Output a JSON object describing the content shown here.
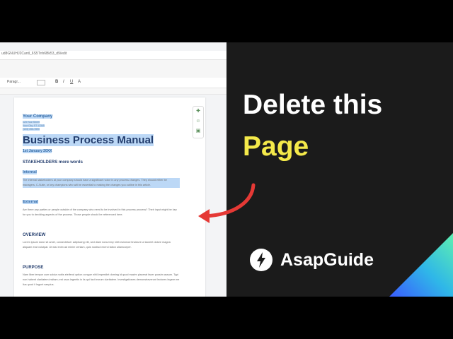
{
  "browser": {
    "url_fragment": "ud8GNUHJ2Cantl_6S5Tnh6Bk53_d9/edit"
  },
  "toolbar": {
    "style_select": "Paragr...",
    "bold": "B",
    "italic": "I",
    "underline": "U",
    "text_color": "A"
  },
  "document": {
    "company": "Your Company",
    "address_lines": [
      "123 Your Street",
      "Your City, ST 12345",
      "(123) 456-7890"
    ],
    "title": "Business Process Manual",
    "date": "1st January 20XX",
    "stakeholders_heading": "STAKEHOLDERS more words",
    "internal_heading": "Internal",
    "internal_text": "The internal stakeholders at your company should have a significant voice in any process changes. They should either be managers, C-Suite, or key champions who will be essential to making the changes you outline in this article.",
    "external_heading": "External",
    "external_text": "Are there any parties or people outside of the company who need to be involved in this process process? Their input might be key for you to deciding aspects of the process. Those people should be referenced here.",
    "overview_heading": "OVERVIEW",
    "overview_text": "Lorem ipsum dolor sit amet, consectetuer adipiscing elit, sed diam nonummy nibh euismod tincidunt ut laoreet dolore magna aliquam erat volutpat. Ut wisi enim ad minim veniam, quis nostrud exerci tation ullamcorper.",
    "purpose_heading": "PURPOSE",
    "purpose_text": "Nam liber tempor cum soluta nobis eleifend option congue nihil imperdiet doming id quod mazim placerat facer possim assum. Typi non habent claritatem insitam; est usus legentis in iis qui facit eorum claritatem. Investigationes demonstraverunt lectores legere me lius quod ii legunt saepius."
  },
  "overlay": {
    "headline_line1": "Delete this",
    "headline_line2": "Page",
    "brand_name": "AsapGuide"
  },
  "colors": {
    "headline_accent": "#f4e94a",
    "arrow": "#e53935",
    "selection": "#bcd8f6",
    "doc_heading": "#243e6e"
  },
  "icons": {
    "brand": "lightning-bolt-icon",
    "arrow": "curved-arrow-icon"
  }
}
